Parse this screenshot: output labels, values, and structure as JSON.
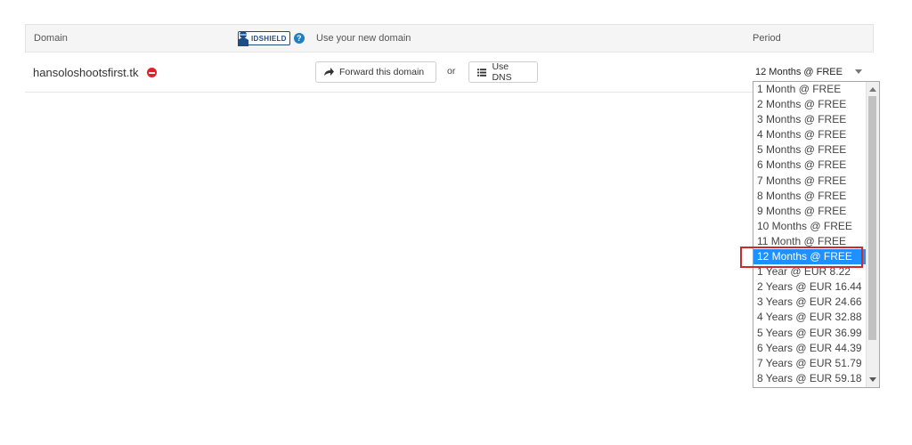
{
  "table": {
    "headers": {
      "domain": "Domain",
      "idshield_badge": "IDSHIELD",
      "idshield_help": "?",
      "new_domain": "Use your new domain",
      "period": "Period"
    },
    "row": {
      "domain_name": "hansoloshootsfirst.tk",
      "forward_button": "Forward this domain",
      "or_text": "or",
      "dns_button": "Use DNS",
      "selected_period": "12 Months @ FREE"
    }
  },
  "dropdown": {
    "options": [
      "1 Month @ FREE",
      "2 Months @ FREE",
      "3 Months @ FREE",
      "4 Months @ FREE",
      "5 Months @ FREE",
      "6 Months @ FREE",
      "7 Months @ FREE",
      "8 Months @ FREE",
      "9 Months @ FREE",
      "10 Months @ FREE",
      "11 Month @ FREE",
      "12 Months @ FREE",
      "1 Year @ EUR 8.22",
      "2 Years @ EUR 16.44",
      "3 Years @ EUR 24.66",
      "4 Years @ EUR 32.88",
      "5 Years @ EUR 36.99",
      "6 Years @ EUR 44.39",
      "7 Years @ EUR 51.79",
      "8 Years @ EUR 59.18"
    ],
    "selected_index": 11
  },
  "colors": {
    "selected_option": "#1e90ff",
    "highlight_border": "#cc2b2b",
    "remove_icon": "#d9262b",
    "idshield_brand": "#1e4d86"
  },
  "icons": {
    "remove": "minus-circle-icon",
    "forward": "share-arrow-icon",
    "dns": "list-icon",
    "help": "question-circle-icon"
  }
}
